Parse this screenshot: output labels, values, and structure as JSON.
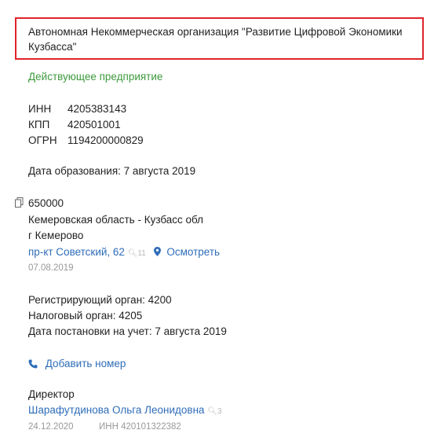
{
  "company": {
    "full_name": "Автономная Некоммерческая организация \"Развитие Цифровой Экономики Кузбасса\"",
    "status": "Действующее предприятие"
  },
  "requisites": [
    {
      "label": "ИНН",
      "value": "4205383143"
    },
    {
      "label": "КПП",
      "value": "420501001"
    },
    {
      "label": "ОГРН",
      "value": "1194200000829"
    }
  ],
  "founded": "Дата образования: 7 августа 2019",
  "address": {
    "zip": "650000",
    "region": "Кемеровская область - Кузбасс обл",
    "city": "г Кемерово",
    "street": "пр-кт Советский, 62",
    "street_count": "11",
    "show_map": "Осмотреть",
    "date": "07.08.2019"
  },
  "registration": {
    "registrar": "Регистрирующий орган: 4200",
    "tax_office": "Налоговый орган: 4205",
    "date": "Дата постановки на учет: 7 августа 2019"
  },
  "phone": {
    "add_label": "Добавить номер"
  },
  "director": {
    "role": "Директор",
    "name": "Шарафутдинова Ольга Леонидовна",
    "count": "3",
    "date": "24.12.2020",
    "inn": "ИНН 420101322382"
  },
  "colors": {
    "highlight_border": "#e0242a",
    "status_green": "#3d9a3d",
    "link_blue": "#2f6db8",
    "muted_gray": "#999999"
  }
}
